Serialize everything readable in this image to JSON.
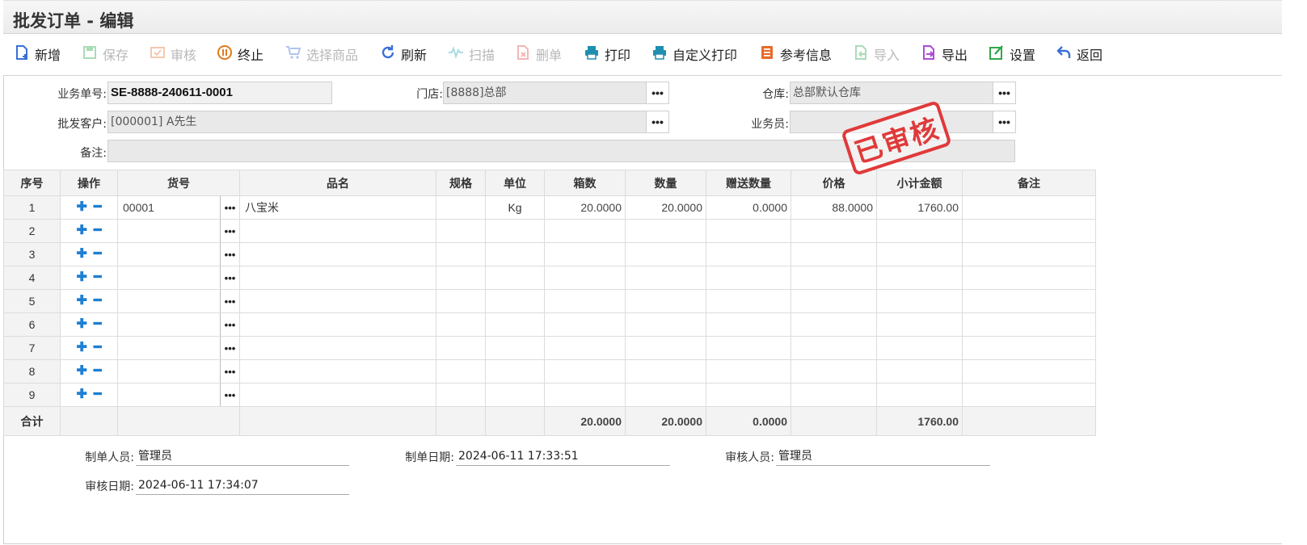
{
  "window": {
    "title": "批发订单 - 编辑"
  },
  "toolbar": {
    "buttons": [
      {
        "label": "新增",
        "icon": "new-doc-icon",
        "enabled": true,
        "color": "#3a6fd8"
      },
      {
        "label": "保存",
        "icon": "save-icon",
        "enabled": false,
        "color": "#2ea84a"
      },
      {
        "label": "审核",
        "icon": "approve-icon",
        "enabled": false,
        "color": "#e07a3a"
      },
      {
        "label": "终止",
        "icon": "stop-icon",
        "enabled": true,
        "color": "#e07a1a"
      },
      {
        "label": "选择商品",
        "icon": "cart-icon",
        "enabled": false,
        "color": "#3a6fd8"
      },
      {
        "label": "刷新",
        "icon": "refresh-icon",
        "enabled": true,
        "color": "#3a6fd8"
      },
      {
        "label": "扫描",
        "icon": "scan-icon",
        "enabled": false,
        "color": "#2eaab5"
      },
      {
        "label": "删单",
        "icon": "delete-doc-icon",
        "enabled": false,
        "color": "#e04a4a"
      },
      {
        "label": "打印",
        "icon": "print-icon",
        "enabled": true,
        "color": "#1f8fb0"
      },
      {
        "label": "自定义打印",
        "icon": "custom-print-icon",
        "enabled": true,
        "color": "#1f8fb0"
      },
      {
        "label": "参考信息",
        "icon": "info-icon",
        "enabled": true,
        "color": "#e86a2a"
      },
      {
        "label": "导入",
        "icon": "import-icon",
        "enabled": false,
        "color": "#2ea84a"
      },
      {
        "label": "导出",
        "icon": "export-icon",
        "enabled": true,
        "color": "#b04ad8"
      },
      {
        "label": "设置",
        "icon": "settings-icon",
        "enabled": true,
        "color": "#2ea84a"
      },
      {
        "label": "返回",
        "icon": "back-icon",
        "enabled": true,
        "color": "#3a6fd8"
      }
    ]
  },
  "form": {
    "order_no": {
      "label": "业务单号:",
      "value": "SE-8888-240611-0001"
    },
    "store": {
      "label": "门店:",
      "value": "[8888]总部"
    },
    "warehouse": {
      "label": "仓库:",
      "value": "总部默认仓库"
    },
    "customer": {
      "label": "批发客户:",
      "value": "[000001] A先生"
    },
    "salesman": {
      "label": "业务员:",
      "value": ""
    },
    "remark": {
      "label": "备注:",
      "value": ""
    },
    "dots": "•••"
  },
  "stamp": {
    "text": "已审核",
    "color": "#e03a3a"
  },
  "grid": {
    "headers": [
      "序号",
      "操作",
      "货号",
      "品名",
      "规格",
      "单位",
      "箱数",
      "数量",
      "赠送数量",
      "价格",
      "小计金额",
      "备注"
    ],
    "plus": "✚",
    "minus": "━",
    "rows": [
      {
        "idx": "1",
        "code": "00001",
        "name": "八宝米",
        "spec": "",
        "unit": "Kg",
        "boxes": "20.0000",
        "qty": "20.0000",
        "gift": "0.0000",
        "price": "88.0000",
        "amount": "1760.00",
        "remark": ""
      },
      {
        "idx": "2",
        "code": "",
        "name": "",
        "spec": "",
        "unit": "",
        "boxes": "",
        "qty": "",
        "gift": "",
        "price": "",
        "amount": "",
        "remark": ""
      },
      {
        "idx": "3",
        "code": "",
        "name": "",
        "spec": "",
        "unit": "",
        "boxes": "",
        "qty": "",
        "gift": "",
        "price": "",
        "amount": "",
        "remark": ""
      },
      {
        "idx": "4",
        "code": "",
        "name": "",
        "spec": "",
        "unit": "",
        "boxes": "",
        "qty": "",
        "gift": "",
        "price": "",
        "amount": "",
        "remark": ""
      },
      {
        "idx": "5",
        "code": "",
        "name": "",
        "spec": "",
        "unit": "",
        "boxes": "",
        "qty": "",
        "gift": "",
        "price": "",
        "amount": "",
        "remark": ""
      },
      {
        "idx": "6",
        "code": "",
        "name": "",
        "spec": "",
        "unit": "",
        "boxes": "",
        "qty": "",
        "gift": "",
        "price": "",
        "amount": "",
        "remark": ""
      },
      {
        "idx": "7",
        "code": "",
        "name": "",
        "spec": "",
        "unit": "",
        "boxes": "",
        "qty": "",
        "gift": "",
        "price": "",
        "amount": "",
        "remark": ""
      },
      {
        "idx": "8",
        "code": "",
        "name": "",
        "spec": "",
        "unit": "",
        "boxes": "",
        "qty": "",
        "gift": "",
        "price": "",
        "amount": "",
        "remark": ""
      },
      {
        "idx": "9",
        "code": "",
        "name": "",
        "spec": "",
        "unit": "",
        "boxes": "",
        "qty": "",
        "gift": "",
        "price": "",
        "amount": "",
        "remark": ""
      }
    ],
    "totals": {
      "label": "合计",
      "boxes": "20.0000",
      "qty": "20.0000",
      "gift": "0.0000",
      "amount": "1760.00"
    }
  },
  "footer": {
    "creator": {
      "label": "制单人员:",
      "value": "管理员"
    },
    "created_at": {
      "label": "制单日期:",
      "value": "2024-06-11 17:33:51"
    },
    "auditor": {
      "label": "审核人员:",
      "value": "管理员"
    },
    "audited_at": {
      "label": "审核日期:",
      "value": "2024-06-11 17:34:07"
    }
  }
}
